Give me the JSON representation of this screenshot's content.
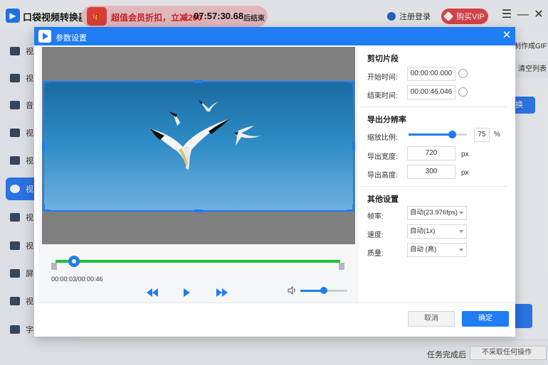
{
  "app": {
    "title": "口袋视频转换器",
    "logo_icon": "app-logo-icon",
    "promo": {
      "text": "超值会员折扣，立减200",
      "countdown": "07:57:30.68",
      "suffix": "后结束"
    },
    "login_label": "注册登录",
    "vip_label": "购买VIP",
    "window_controls": [
      "menu-icon",
      "minimize-icon",
      "close-icon"
    ]
  },
  "sidebar": {
    "items": [
      {
        "label": "视",
        "icon": "video-convert-icon"
      },
      {
        "label": "视",
        "icon": "video-edit-icon"
      },
      {
        "label": "音",
        "icon": "audio-icon"
      },
      {
        "label": "视",
        "icon": "video-play-icon"
      },
      {
        "label": "视",
        "icon": "video-cut-icon"
      },
      {
        "label": "视",
        "icon": "cloud-icon",
        "active": true
      },
      {
        "label": "视",
        "icon": "video-merge-icon"
      },
      {
        "label": "视",
        "icon": "truck-icon"
      },
      {
        "label": "屏",
        "icon": "screen-record-icon"
      },
      {
        "label": "视",
        "icon": "video-subtitle-icon"
      },
      {
        "label": "字",
        "icon": "text-icon"
      }
    ]
  },
  "background": {
    "make_gif": "制作成GIF",
    "clear_list": "清空列表",
    "convert_partial": "换",
    "task_done_label": "任务完成后",
    "task_done_value": "不采取任何操作"
  },
  "dialog": {
    "title": "参数设置",
    "trim": {
      "section": "剪切片段",
      "start_label": "开始时间:",
      "start_value": "00:00:00.000",
      "end_label": "结束时间:",
      "end_value": "00:00:46.046"
    },
    "resolution": {
      "section": "导出分辨率",
      "scale_label": "缩放比例:",
      "scale_value": "75",
      "scale_unit": "%",
      "width_label": "导出宽度:",
      "width_value": "720",
      "height_label": "导出高度:",
      "height_value": "300",
      "unit": "px"
    },
    "other": {
      "section": "其他设置",
      "fps_label": "帧率:",
      "fps_value": "自动(23.976fps)",
      "speed_label": "速度:",
      "speed_value": "自动(1x)",
      "quality_label": "质量:",
      "quality_value": "自动 (高)"
    },
    "player": {
      "time": "00:00:03/00:00:46",
      "playhead_fraction": 0.065,
      "volume_fraction": 0.5
    },
    "cancel_label": "取消",
    "ok_label": "确定",
    "colors": {
      "accent": "#1f7cf2",
      "trim_track": "#1ec335"
    }
  }
}
